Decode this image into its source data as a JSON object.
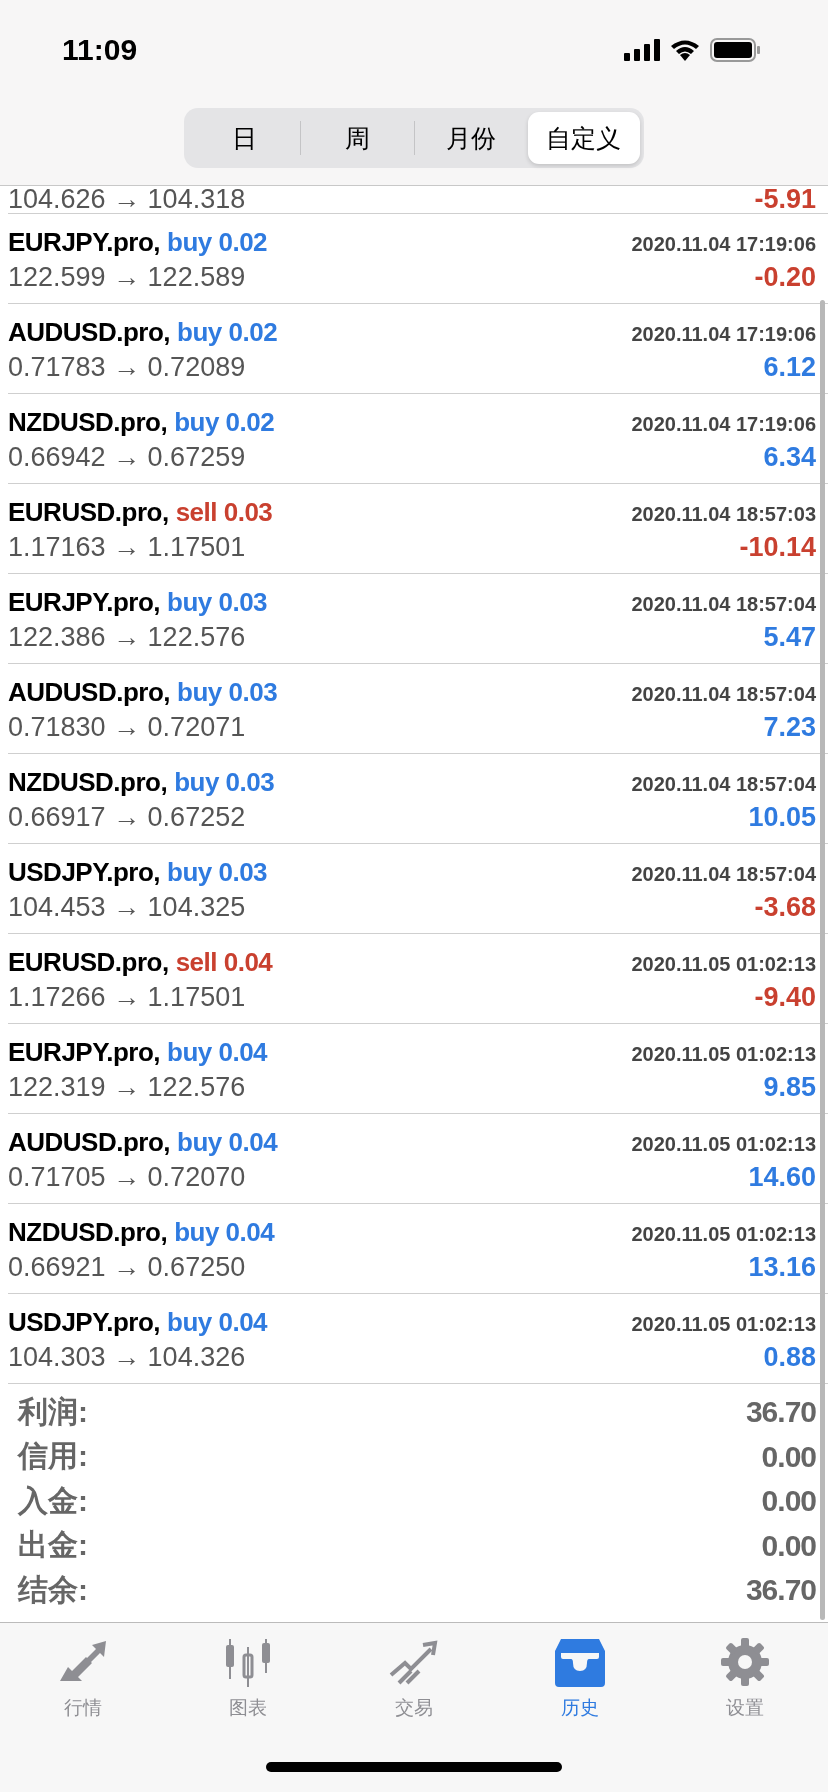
{
  "status_bar": {
    "time": "11:09"
  },
  "segments": [
    {
      "label": "日",
      "selected": false
    },
    {
      "label": "周",
      "selected": false
    },
    {
      "label": "月份",
      "selected": false
    },
    {
      "label": "自定义",
      "selected": true
    }
  ],
  "partial_row": {
    "prices": "104.626 → 104.318",
    "profit": {
      "text": "-5.91",
      "color": "#c9402f"
    }
  },
  "deals": [
    {
      "symbol": "EURJPY.pro,",
      "order": {
        "text": "buy 0.02",
        "color": "#2f7be0"
      },
      "time": "2020.11.04 17:19:06",
      "prices": "122.599 → 122.589",
      "profit": {
        "text": "-0.20",
        "color": "#c9402f"
      }
    },
    {
      "symbol": "AUDUSD.pro,",
      "order": {
        "text": "buy 0.02",
        "color": "#2f7be0"
      },
      "time": "2020.11.04 17:19:06",
      "prices": "0.71783 → 0.72089",
      "profit": {
        "text": "6.12",
        "color": "#2f7be0"
      }
    },
    {
      "symbol": "NZDUSD.pro,",
      "order": {
        "text": "buy 0.02",
        "color": "#2f7be0"
      },
      "time": "2020.11.04 17:19:06",
      "prices": "0.66942 → 0.67259",
      "profit": {
        "text": "6.34",
        "color": "#2f7be0"
      }
    },
    {
      "symbol": "EURUSD.pro,",
      "order": {
        "text": "sell 0.03",
        "color": "#c9402f"
      },
      "time": "2020.11.04 18:57:03",
      "prices": "1.17163 → 1.17501",
      "profit": {
        "text": "-10.14",
        "color": "#c9402f"
      }
    },
    {
      "symbol": "EURJPY.pro,",
      "order": {
        "text": "buy 0.03",
        "color": "#2f7be0"
      },
      "time": "2020.11.04 18:57:04",
      "prices": "122.386 → 122.576",
      "profit": {
        "text": "5.47",
        "color": "#2f7be0"
      }
    },
    {
      "symbol": "AUDUSD.pro,",
      "order": {
        "text": "buy 0.03",
        "color": "#2f7be0"
      },
      "time": "2020.11.04 18:57:04",
      "prices": "0.71830 → 0.72071",
      "profit": {
        "text": "7.23",
        "color": "#2f7be0"
      }
    },
    {
      "symbol": "NZDUSD.pro,",
      "order": {
        "text": "buy 0.03",
        "color": "#2f7be0"
      },
      "time": "2020.11.04 18:57:04",
      "prices": "0.66917 → 0.67252",
      "profit": {
        "text": "10.05",
        "color": "#2f7be0"
      }
    },
    {
      "symbol": "USDJPY.pro,",
      "order": {
        "text": "buy 0.03",
        "color": "#2f7be0"
      },
      "time": "2020.11.04 18:57:04",
      "prices": "104.453 → 104.325",
      "profit": {
        "text": "-3.68",
        "color": "#c9402f"
      }
    },
    {
      "symbol": "EURUSD.pro,",
      "order": {
        "text": "sell 0.04",
        "color": "#c9402f"
      },
      "time": "2020.11.05 01:02:13",
      "prices": "1.17266 → 1.17501",
      "profit": {
        "text": "-9.40",
        "color": "#c9402f"
      }
    },
    {
      "symbol": "EURJPY.pro,",
      "order": {
        "text": "buy 0.04",
        "color": "#2f7be0"
      },
      "time": "2020.11.05 01:02:13",
      "prices": "122.319 → 122.576",
      "profit": {
        "text": "9.85",
        "color": "#2f7be0"
      }
    },
    {
      "symbol": "AUDUSD.pro,",
      "order": {
        "text": "buy 0.04",
        "color": "#2f7be0"
      },
      "time": "2020.11.05 01:02:13",
      "prices": "0.71705 → 0.72070",
      "profit": {
        "text": "14.60",
        "color": "#2f7be0"
      }
    },
    {
      "symbol": "NZDUSD.pro,",
      "order": {
        "text": "buy 0.04",
        "color": "#2f7be0"
      },
      "time": "2020.11.05 01:02:13",
      "prices": "0.66921 → 0.67250",
      "profit": {
        "text": "13.16",
        "color": "#2f7be0"
      }
    },
    {
      "symbol": "USDJPY.pro,",
      "order": {
        "text": "buy 0.04",
        "color": "#2f7be0"
      },
      "time": "2020.11.05 01:02:13",
      "prices": "104.303 → 104.326",
      "profit": {
        "text": "0.88",
        "color": "#2f7be0"
      }
    }
  ],
  "summary": [
    {
      "label": "利润:",
      "value": "36.70"
    },
    {
      "label": "信用:",
      "value": "0.00"
    },
    {
      "label": "入金:",
      "value": "0.00"
    },
    {
      "label": "出金:",
      "value": "0.00"
    },
    {
      "label": "结余:",
      "value": "36.70"
    }
  ],
  "tab_bar": [
    {
      "kind": "quotes",
      "label": "行情",
      "selected": false
    },
    {
      "kind": "chart",
      "label": "图表",
      "selected": false
    },
    {
      "kind": "trade",
      "label": "交易",
      "selected": false
    },
    {
      "kind": "history",
      "label": "历史",
      "selected": true
    },
    {
      "kind": "settings",
      "label": "设置",
      "selected": false
    }
  ]
}
